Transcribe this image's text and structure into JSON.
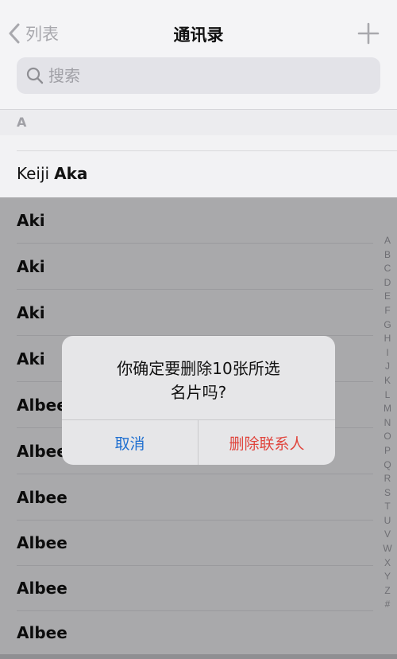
{
  "header": {
    "back_label": "列表",
    "title": "通讯录"
  },
  "search": {
    "placeholder": "搜索"
  },
  "section": {
    "letter": "A"
  },
  "contacts": [
    {
      "first": "Keiji",
      "last": "Aka"
    },
    {
      "name": "Aki"
    },
    {
      "name": "Aki"
    },
    {
      "name": "Aki"
    },
    {
      "name": "Aki"
    },
    {
      "name": "Albee"
    },
    {
      "name": "Albee"
    },
    {
      "name": "Albee"
    },
    {
      "name": "Albee"
    },
    {
      "name": "Albee"
    },
    {
      "name": "Albee"
    }
  ],
  "index_letters": [
    "A",
    "B",
    "C",
    "D",
    "E",
    "F",
    "G",
    "H",
    "I",
    "J",
    "K",
    "L",
    "M",
    "N",
    "O",
    "P",
    "Q",
    "R",
    "S",
    "T",
    "U",
    "V",
    "W",
    "X",
    "Y",
    "Z",
    "#"
  ],
  "alert": {
    "message_line1": "你确定要删除10张所选",
    "message_line2": "名片吗?",
    "cancel_label": "取消",
    "delete_label": "删除联系人"
  },
  "colors": {
    "cancel": "#1f6fd0",
    "destructive": "#e0463e",
    "dim_overlay": "#a9a9ab"
  },
  "icons": {
    "back": "chevron-left-icon",
    "add": "plus-icon",
    "search": "magnifier-icon"
  }
}
